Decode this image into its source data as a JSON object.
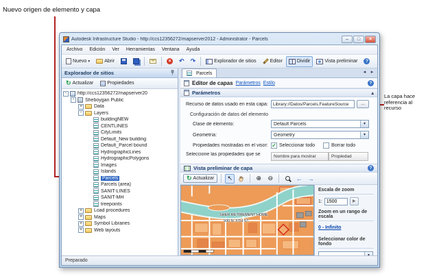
{
  "annotations": {
    "top_callout": "Nuevo origen de elemento y capa",
    "right_callout": "La capa hace referencia al recurso"
  },
  "icons": {
    "dropdown": "▾",
    "minimize": "–",
    "maximize": "□",
    "close": "×",
    "stop": "×",
    "help": "?",
    "check": "✓",
    "undo": "↶",
    "redo": "↷",
    "refresh": "↻",
    "select_tool": "↖",
    "pan_tool": "✛",
    "zoom_in": "⊕",
    "zoom_out": "⊖",
    "back": "←",
    "forward": "→",
    "go": "▶",
    "tab_prev": "◂",
    "tab_next": "▸",
    "collapse": "▴"
  },
  "window": {
    "title": "Autodesk Infrastructure Studio - http://ccs12356272/mapserver2012 - Administrator - Parcels"
  },
  "menu": {
    "items": [
      "Archivo",
      "Edición",
      "Ver",
      "Herramientas",
      "Ventana",
      "Ayuda"
    ]
  },
  "toolbar": {
    "new_label": "Nuevo",
    "open_label": "Abrir",
    "site_explorer_label": "Explorador de sitios",
    "editor_label": "Editor",
    "split_label": "Dividir",
    "preview_label": "Vista preliminar"
  },
  "explorer": {
    "title": "Explorador de sitios",
    "refresh_label": "Actualizar",
    "properties_label": "Propiedades"
  },
  "tree": {
    "items": [
      {
        "label": "http://ccs12356272/mapserver20",
        "exp": "-"
      },
      {
        "label": "Sheboygan Public",
        "exp": "-"
      },
      {
        "label": "Data",
        "exp": "+"
      },
      {
        "label": "Layers",
        "exp": "-"
      },
      {
        "label": "buildingNEW"
      },
      {
        "label": "CENTLINES"
      },
      {
        "label": "CityLimits"
      },
      {
        "label": "Default_New building"
      },
      {
        "label": "Default_Parcel bound"
      },
      {
        "label": "HydrographicLines"
      },
      {
        "label": "HydrographicPolygons"
      },
      {
        "label": "Images"
      },
      {
        "label": "Islands"
      },
      {
        "label": "Parcels"
      },
      {
        "label": "Parcels (area)"
      },
      {
        "label": "SANIT-LINES"
      },
      {
        "label": "SANIT-MH"
      },
      {
        "label": "treepoints"
      },
      {
        "label": "Load procedures",
        "exp": "+"
      },
      {
        "label": "Maps",
        "exp": "+"
      },
      {
        "label": "Symbol Libraries",
        "exp": "+"
      },
      {
        "label": "Web layouts",
        "exp": "+"
      }
    ]
  },
  "editor": {
    "tab_label": "Parcels",
    "title": "Editor de capas",
    "link_parametros": "Parámetros",
    "link_estilo": "Estilo"
  },
  "parametros": {
    "header": "Parámetros",
    "resource_label": "Recurso de datos usado en esta capa:",
    "resource_value": "Library://Datos/Parcels.FeatureSource",
    "browse_label": "...",
    "group_title": "Configuración de datos del elemento",
    "class_label": "Clase de elemento:",
    "class_value": "Default Parcels",
    "geometry_label": "Geometría:",
    "geometry_value": "Geometry",
    "shown_props_label": "Propiedades mostradas en el visor:",
    "select_all_label": "Seleccionar todo",
    "clear_all_label": "Borrar todo",
    "select_props_label": "Seleccione las propiedades que se",
    "col_display": "Nombre para mostrar",
    "col_property": "Propiedad"
  },
  "preview": {
    "header": "Vista preliminar de capa",
    "refresh_label": "Actualizar",
    "map_label_1": "SHER RETIREMENT HOME",
    "map_label_2": "930 N. 6TH ST.",
    "scale_title": "Escala de zoom",
    "scale_prefix": "1:",
    "scale_value": "1500",
    "range_title": "Zoom en un rango de escala",
    "range_link": "0 - Infinito",
    "bg_title": "Seleccionar color de fondo"
  },
  "statusbar": {
    "text": "Preparado"
  }
}
